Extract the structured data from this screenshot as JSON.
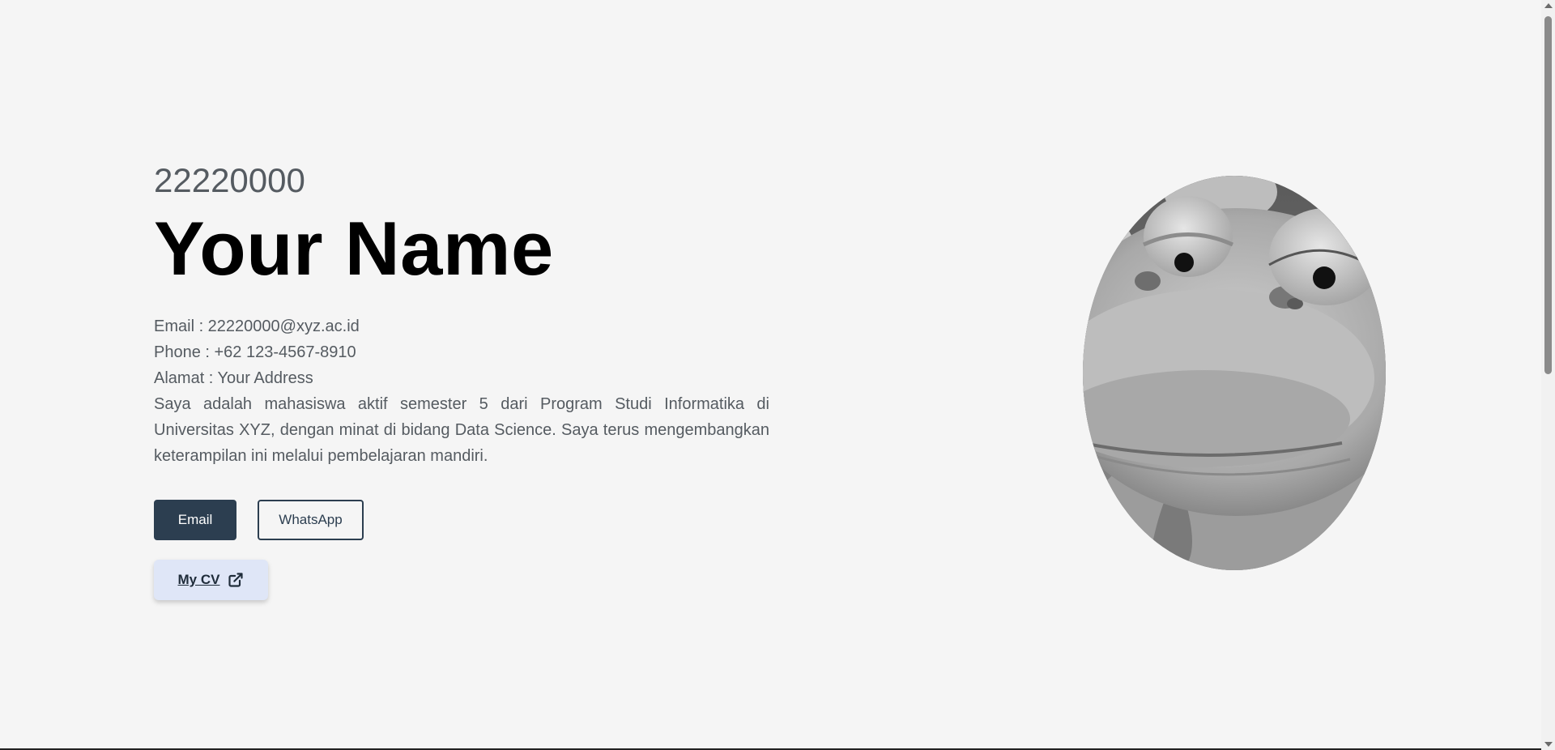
{
  "hero": {
    "nim": "22220000",
    "name": "Your Name",
    "email_line": "Email : 22220000@xyz.ac.id",
    "phone_line": "Phone : +62 123-4567-8910",
    "address_line": "Alamat : Your Address",
    "bio": "Saya adalah mahasiswa aktif semester 5 dari Program Studi Informatika di Universitas XYZ, dengan minat di bidang Data Science. Saya terus mengembangkan keterampilan ini melalui pembelajaran mandiri."
  },
  "buttons": {
    "email_label": "Email",
    "whatsapp_label": "WhatsApp",
    "cv_label": "My CV"
  },
  "icons": {
    "cv": "external-link-icon",
    "photo": "profile-photo"
  },
  "colors": {
    "background": "#f5f5f5",
    "primary": "#2c3e50",
    "cv_button_bg": "#dfe6f7",
    "text_muted": "#555b61"
  }
}
